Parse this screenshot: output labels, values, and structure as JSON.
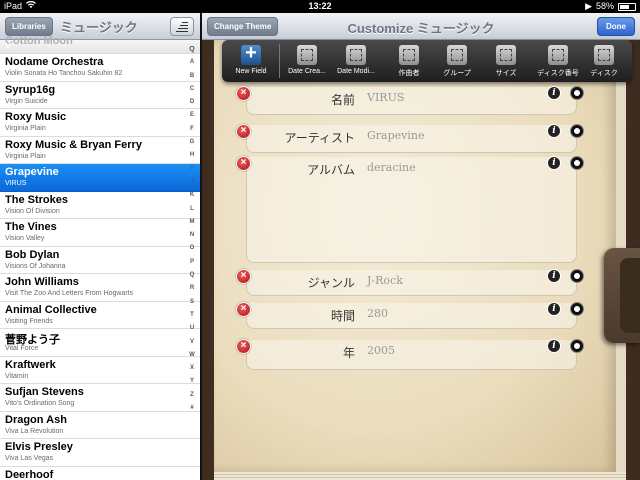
{
  "statusbar": {
    "device": "iPad",
    "time": "13:22",
    "battery": "58%"
  },
  "left": {
    "back_label": "Libraries",
    "title": "ミュージック",
    "ghost_row": {
      "title": "Cotton Moon",
      "letter": "V"
    },
    "rows": [
      {
        "title": "Nodame Orchestra",
        "sub": "Violin Sonata Ho Tanchou Sakuhin 82"
      },
      {
        "title": "Syrup16g",
        "sub": "Virgin Suicide"
      },
      {
        "title": "Roxy Music",
        "sub": "Virginia Plain"
      },
      {
        "title": "Roxy Music & Bryan Ferry",
        "sub": "Virginia Plain"
      },
      {
        "title": "Grapevine",
        "sub": "VIRUS",
        "selected": true
      },
      {
        "title": "The Strokes",
        "sub": "Vision Of Division"
      },
      {
        "title": "The Vines",
        "sub": "Vision Valley"
      },
      {
        "title": "Bob Dylan",
        "sub": "Visions Of Johanna"
      },
      {
        "title": "John Williams",
        "sub": "Visit The Zoo And Letters From Hogwarts"
      },
      {
        "title": "Animal Collective",
        "sub": "Visiting Friends"
      },
      {
        "title": "菅野よう子",
        "sub": "Vital Force"
      },
      {
        "title": "Kraftwerk",
        "sub": "Vitamin"
      },
      {
        "title": "Sufjan Stevens",
        "sub": "Vito's Ordination Song"
      },
      {
        "title": "Dragon Ash",
        "sub": "Viva La Revolution"
      },
      {
        "title": "Elvis Presley",
        "sub": "Viva Las Vegas"
      },
      {
        "title": "Deerhoof",
        "sub": ""
      }
    ],
    "index": [
      "Q",
      "A",
      "B",
      "C",
      "D",
      "E",
      "F",
      "G",
      "H",
      "I",
      "J",
      "K",
      "L",
      "M",
      "N",
      "O",
      "P",
      "Q",
      "R",
      "S",
      "T",
      "U",
      "V",
      "W",
      "X",
      "Y",
      "Z",
      "#"
    ]
  },
  "right": {
    "left_button": "Change Theme",
    "title": "Customize ミュージック",
    "done_label": "Done",
    "toolbar": [
      {
        "label": "New Field",
        "icon": "plus-icon"
      },
      {
        "label": "Date Crea...",
        "icon": "field-icon"
      },
      {
        "label": "Date Modi...",
        "icon": "field-icon"
      },
      {
        "label": "作曲者",
        "icon": "field-icon"
      },
      {
        "label": "グループ",
        "icon": "field-icon"
      },
      {
        "label": "サイズ",
        "icon": "field-icon"
      },
      {
        "label": "ディスク番号",
        "icon": "field-icon"
      },
      {
        "label": "ディスク",
        "icon": "field-icon"
      }
    ],
    "fields": [
      {
        "label": "名前",
        "value": "VIRUS"
      },
      {
        "label": "アーティスト",
        "value": "Grapevine"
      },
      {
        "label": "アルバム",
        "value": "deracine"
      },
      {
        "label": "ジャンル",
        "value": "J-Rock"
      },
      {
        "label": "時間",
        "value": "280"
      },
      {
        "label": "年",
        "value": "2005"
      }
    ]
  },
  "colors": {
    "selection": "#0a68d8",
    "delete": "#c81a1a",
    "nav_text": "#6e7682"
  }
}
